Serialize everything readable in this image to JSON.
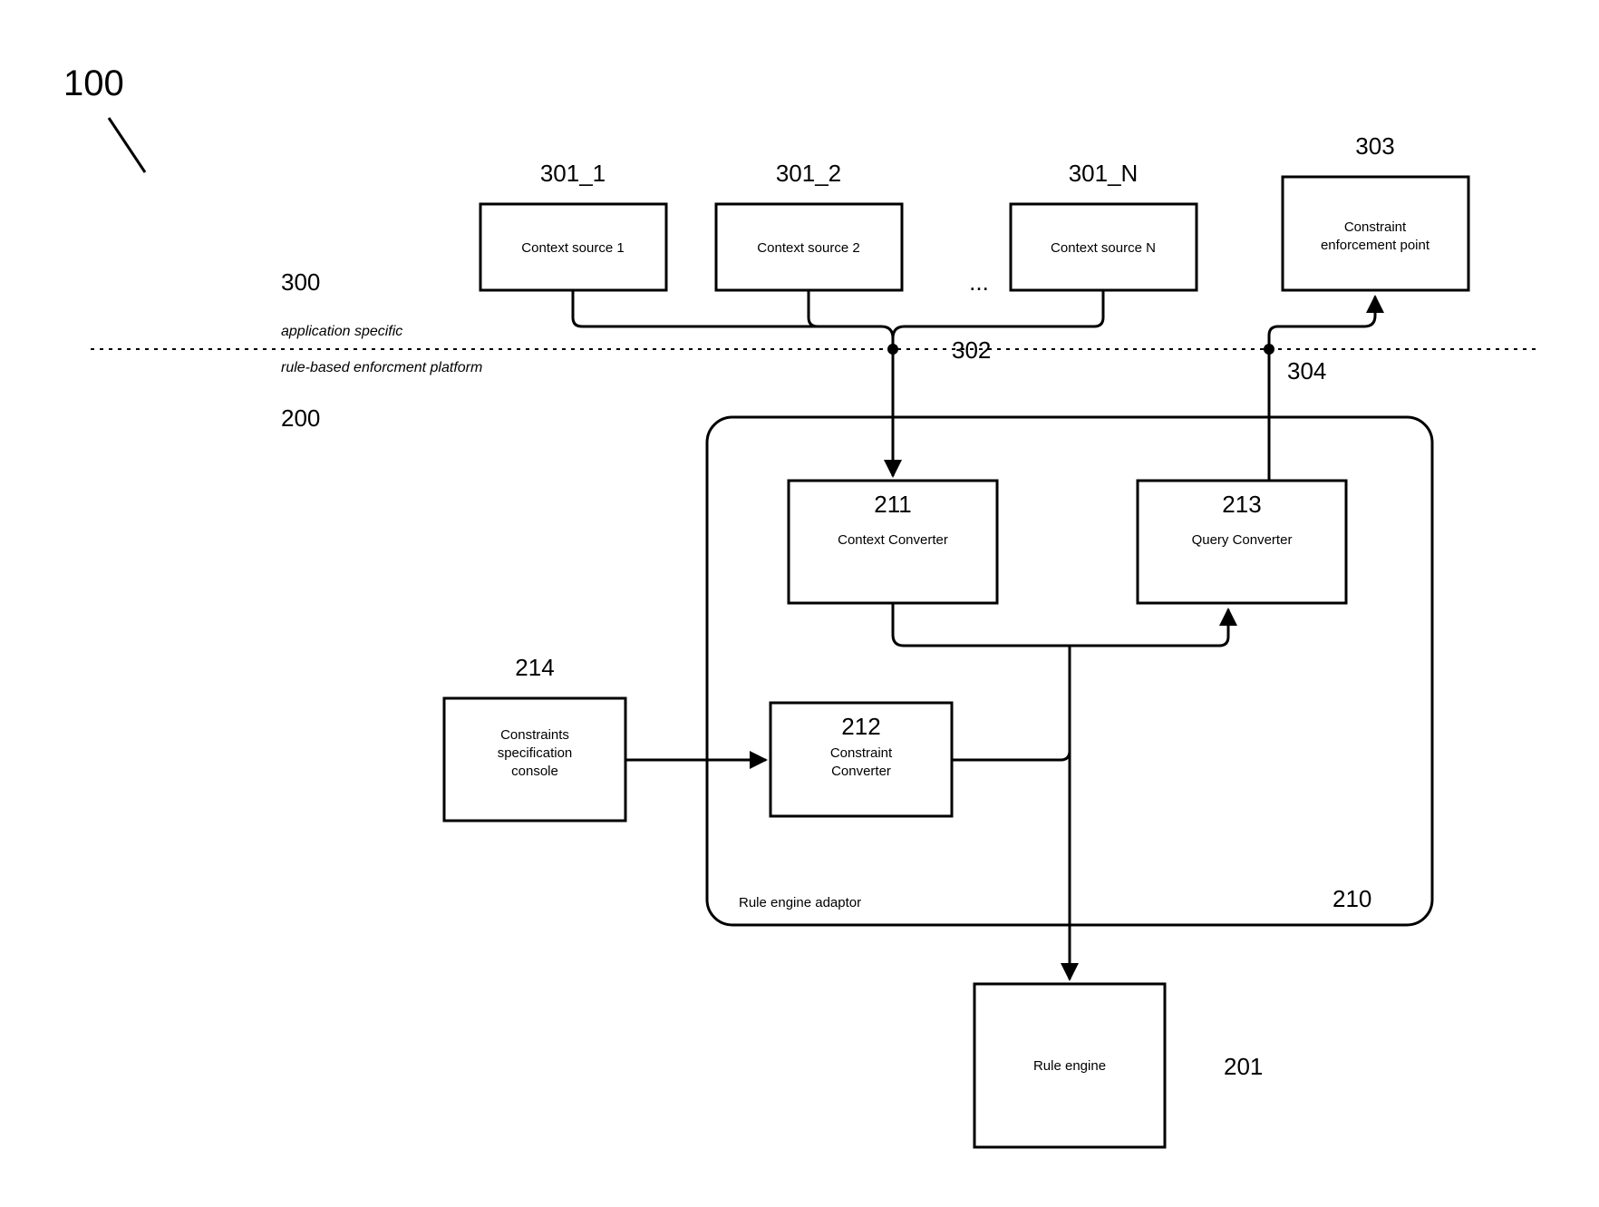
{
  "figure_id_label": "100",
  "divider": {
    "upper_region_label": "application specific",
    "upper_region_num": "300",
    "lower_region_label": "rule-based enforcment platform",
    "lower_region_num": "200"
  },
  "context_sources": {
    "items": [
      {
        "num": "301_1",
        "label": "Context source 1"
      },
      {
        "num": "301_2",
        "label": "Context source 2"
      },
      {
        "num": "301_N",
        "label": "Context source N"
      }
    ],
    "ellipsis": "..."
  },
  "constraint_enforcement_point": {
    "num": "303",
    "label_1": "Constraint",
    "label_2": "enforcement point"
  },
  "junction_labels": {
    "context_in": "302",
    "query_out": "304"
  },
  "rule_engine_adaptor": {
    "num": "210",
    "label": "Rule engine adaptor"
  },
  "context_converter": {
    "num": "211",
    "label": "Context Converter"
  },
  "constraint_converter": {
    "num": "212",
    "label_1": "Constraint",
    "label_2": "Converter"
  },
  "query_converter": {
    "num": "213",
    "label": "Query Converter"
  },
  "constraints_console": {
    "num": "214",
    "label_1": "Constraints",
    "label_2": "specification",
    "label_3": "console"
  },
  "rule_engine": {
    "num": "201",
    "label": "Rule engine"
  }
}
